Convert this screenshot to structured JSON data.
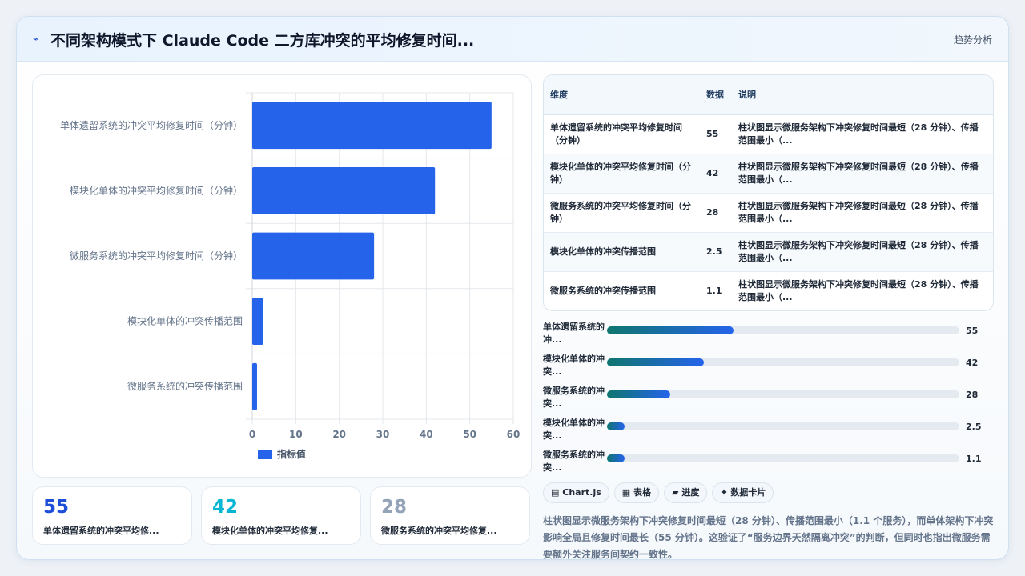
{
  "header": {
    "title": "不同架构模式下 Claude Code 二方库冲突的平均修复时间...",
    "link": "趋势分析"
  },
  "chart_data": {
    "type": "bar",
    "orientation": "horizontal",
    "categories": [
      "单体遗留系统的冲突平均修复时间（分钟）",
      "模块化单体的冲突平均修复时间（分钟）",
      "微服务系统的冲突平均修复时间（分钟）",
      "模块化单体的冲突传播范围",
      "微服务系统的冲突传播范围"
    ],
    "series": [
      {
        "name": "指标值",
        "values": [
          55,
          42,
          28,
          2.5,
          1.1
        ],
        "color": "#2563eb"
      }
    ],
    "xlim": [
      0,
      60
    ],
    "xticks": [
      0,
      10,
      20,
      30,
      40,
      50,
      60
    ],
    "grid": true,
    "legend": "bottom"
  },
  "stats": [
    {
      "value": "55",
      "label": "单体遗留系统的冲突平均修...",
      "color": "#1d4ed8"
    },
    {
      "value": "42",
      "label": "模块化单体的冲突平均修复...",
      "color": "#06b6d4"
    },
    {
      "value": "28",
      "label": "微服务系统的冲突平均修复...",
      "color": "#94a3b8"
    }
  ],
  "table": {
    "headers": [
      "维度",
      "数据",
      "说明"
    ],
    "rows": [
      [
        "单体遗留系统的冲突平均修复时间（分钟）",
        "55",
        "柱状图显示微服务架构下冲突修复时间最短（28 分钟）、传播范围最小（..."
      ],
      [
        "模块化单体的冲突平均修复时间（分钟）",
        "42",
        "柱状图显示微服务架构下冲突修复时间最短（28 分钟）、传播范围最小（..."
      ],
      [
        "微服务系统的冲突平均修复时间（分钟）",
        "28",
        "柱状图显示微服务架构下冲突修复时间最短（28 分钟）、传播范围最小（..."
      ],
      [
        "模块化单体的冲突传播范围",
        "2.5",
        "柱状图显示微服务架构下冲突修复时间最短（28 分钟）、传播范围最小（..."
      ],
      [
        "微服务系统的冲突传播范围",
        "1.1",
        "柱状图显示微服务架构下冲突修复时间最短（28 分钟）、传播范围最小（..."
      ]
    ]
  },
  "progress": [
    {
      "label": "单体遗留系统的冲...",
      "value": "55",
      "fraction": 0.36
    },
    {
      "label": "模块化单体的冲突...",
      "value": "42",
      "fraction": 0.275
    },
    {
      "label": "微服务系统的冲突...",
      "value": "28",
      "fraction": 0.18
    },
    {
      "label": "模块化单体的冲突...",
      "value": "2.5",
      "fraction": 0.05
    },
    {
      "label": "微服务系统的冲突...",
      "value": "1.1",
      "fraction": 0.05
    }
  ],
  "tags": [
    {
      "icon": "▤",
      "label": "Chart.js"
    },
    {
      "icon": "▦",
      "label": "表格"
    },
    {
      "icon": "▰",
      "label": "进度"
    },
    {
      "icon": "✦",
      "label": "数据卡片"
    }
  ],
  "summary": "柱状图显示微服务架构下冲突修复时间最短（28 分钟）、传播范围最小（1.1 个服务），而单体架构下冲突影响全局且修复时间最长（55 分钟）。这验证了“服务边界天然隔离冲突”的判断，但同时也指出微服务需要额外关注服务间契约一致性。"
}
